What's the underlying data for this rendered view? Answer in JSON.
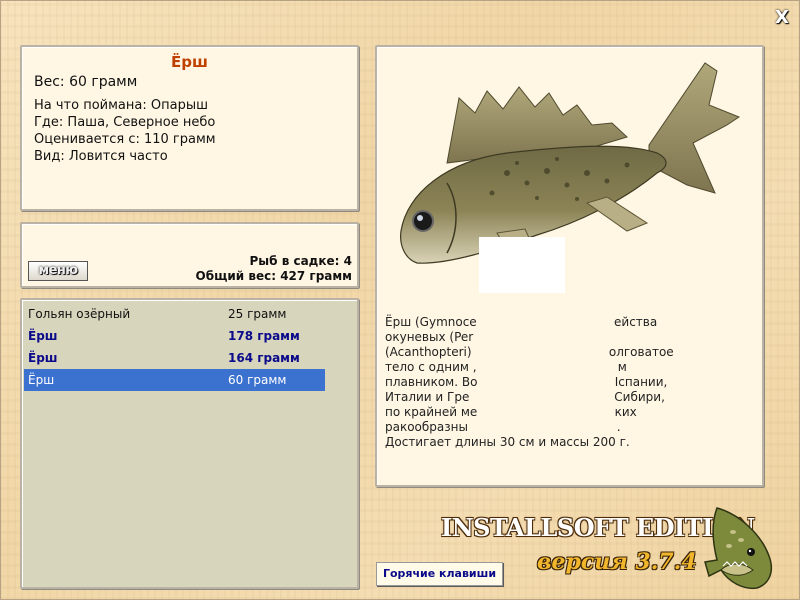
{
  "window": {
    "close_glyph": "X"
  },
  "fish_info": {
    "name": "Ёрш",
    "weight": "Вес: 60 грамм",
    "caught_on": "На что поймана: Опарыш",
    "location": "Где: Паша, Северное небо",
    "price": "Оценивается с: 110 грамм",
    "kind": "Вид: Ловится часто"
  },
  "menu_button": "меню",
  "keepnet": {
    "count": "Рыб в садке: 4",
    "total": "Общий вес: 427 грамм"
  },
  "catch_list": [
    {
      "name": "Гольян озёрный",
      "weight": "25 грамм",
      "style": "normal"
    },
    {
      "name": "Ёрш",
      "weight": "178 грамм",
      "style": "bold"
    },
    {
      "name": "Ёрш",
      "weight": "164 грамм",
      "style": "bold"
    },
    {
      "name": "Ёрш",
      "weight": "60 грамм",
      "style": "selected"
    }
  ],
  "description": {
    "lines": [
      "Ёрш (Gymnoce                                    ейства",
      "окуневых (Per",
      "(Acanthopteri)                                    олговатое",
      "тело с одним ,                                     м",
      "плавником. Во                                    Іспании,",
      "Италии и Гре                                      Сибири,",
      "по крайней ме                                    ких",
      "ракообразны                                       .",
      "Достигает длины 30 см и массы 200 г."
    ]
  },
  "hotkeys_button": "Горячие клавиши",
  "branding": {
    "edition": "INSTALLSOFT EDITION",
    "version": "версия 3.7.4"
  },
  "icons": {
    "close": "close-icon",
    "fish": "ruffe-fish-image",
    "logo": "pike-logo-icon"
  },
  "colors": {
    "title": "#c04000",
    "selection": "#3b71cf",
    "bold_row": "#0a0a8a",
    "version": "#f2b62d"
  }
}
